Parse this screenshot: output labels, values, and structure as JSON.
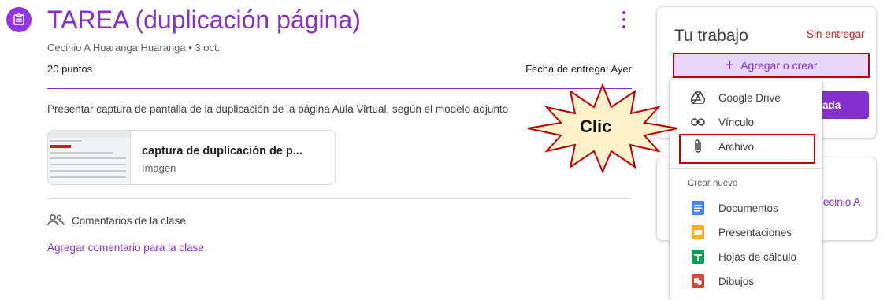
{
  "assignment": {
    "title": "TAREA (duplicación página)",
    "author_date": "Cecinio A Huaranga Huaranga • 3 oct.",
    "points": "20 puntos",
    "due": "Fecha de entrega: Ayer",
    "description": "Presentar captura de pantalla de la duplicación de la página Aula Virtual, según el modelo adjunto",
    "attachment": {
      "name": "captura de duplicación de p...",
      "type": "Imagen"
    },
    "comments_label": "Comentarios de la clase",
    "add_comment": "Agregar comentario para la clase"
  },
  "work_panel": {
    "title": "Tu trabajo",
    "status": "Sin entregar",
    "add_button": "Agregar o crear",
    "mark_button_partial": "ada",
    "teacher_partial": "ecinio A"
  },
  "menu": {
    "items": [
      {
        "label": "Google Drive",
        "icon": "google-drive-icon"
      },
      {
        "label": "Vínculo",
        "icon": "link-icon"
      },
      {
        "label": "Archivo",
        "icon": "paperclip-icon"
      }
    ],
    "create_heading": "Crear nuevo",
    "create_items": [
      {
        "label": "Documentos",
        "icon": "google-docs-icon"
      },
      {
        "label": "Presentaciones",
        "icon": "google-slides-icon"
      },
      {
        "label": "Hojas de cálculo",
        "icon": "google-sheets-icon"
      },
      {
        "label": "Dibujos",
        "icon": "google-drawings-icon"
      }
    ]
  },
  "annotation": {
    "callout": "Clic"
  },
  "colors": {
    "accent": "#8430ce",
    "status_red": "#c5221f",
    "highlight_border": "#c00000",
    "burst_fill": "#fff2cc"
  }
}
